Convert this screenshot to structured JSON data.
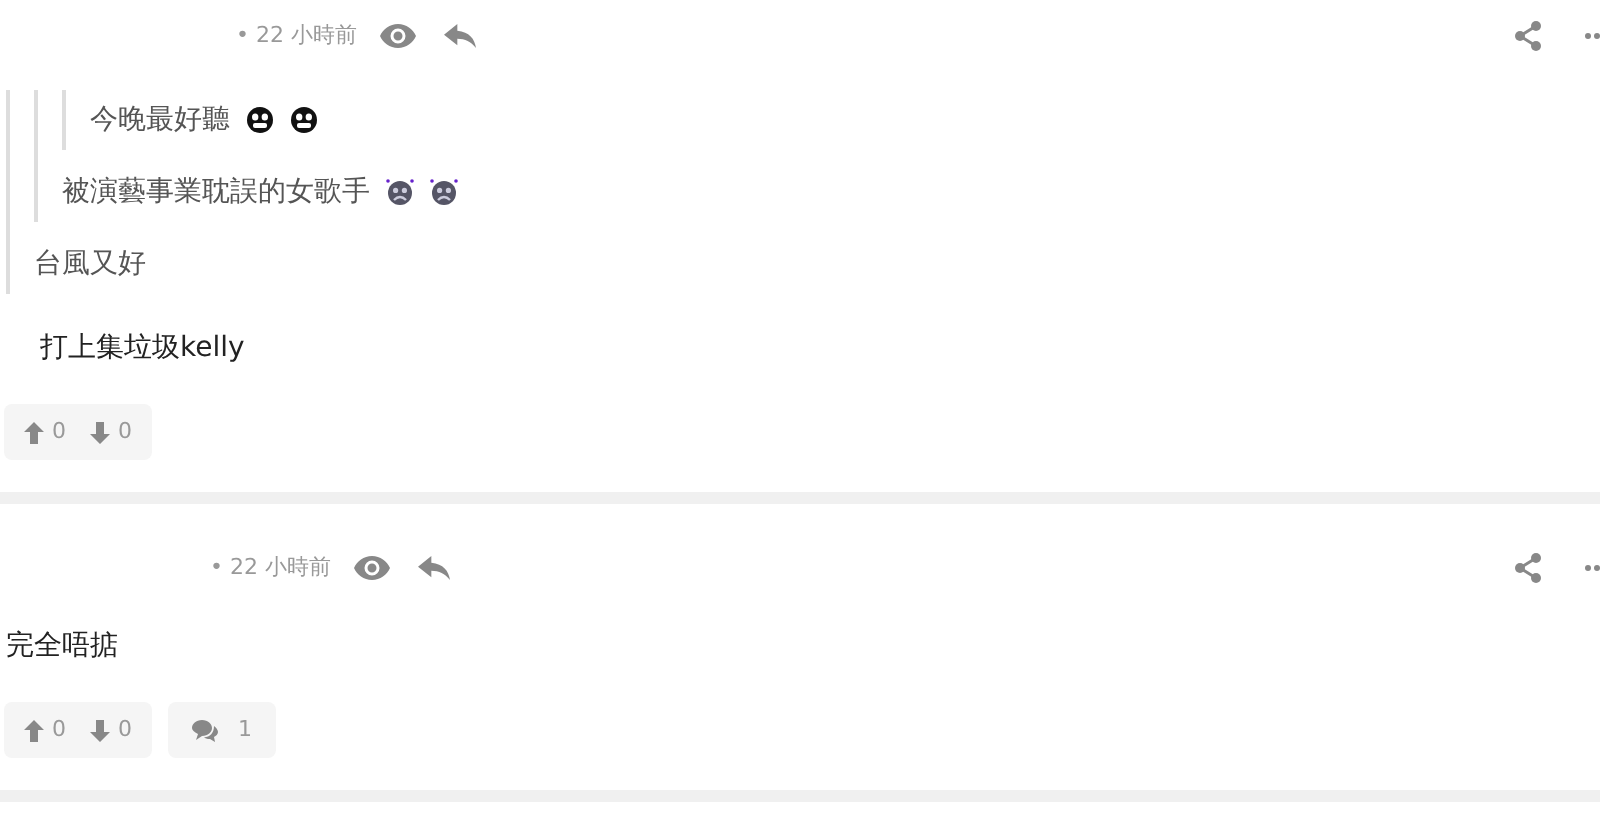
{
  "comments": [
    {
      "time": "• 22 小時前",
      "quote": {
        "text": "台風又好",
        "quote": {
          "text": "被演藝事業耽誤的女歌手",
          "emojis": [
            {
              "kind": "sad"
            },
            {
              "kind": "sad"
            }
          ],
          "quote": {
            "text": "今晚最好聽",
            "emojis": [
              {
                "kind": "grin"
              },
              {
                "kind": "grin"
              }
            ]
          }
        }
      },
      "body": "打上集垃圾kelly",
      "upvotes": "0",
      "downvotes": "0"
    },
    {
      "time": "• 22 小時前",
      "body": "完全唔掂",
      "upvotes": "0",
      "downvotes": "0",
      "replies": "1"
    }
  ]
}
